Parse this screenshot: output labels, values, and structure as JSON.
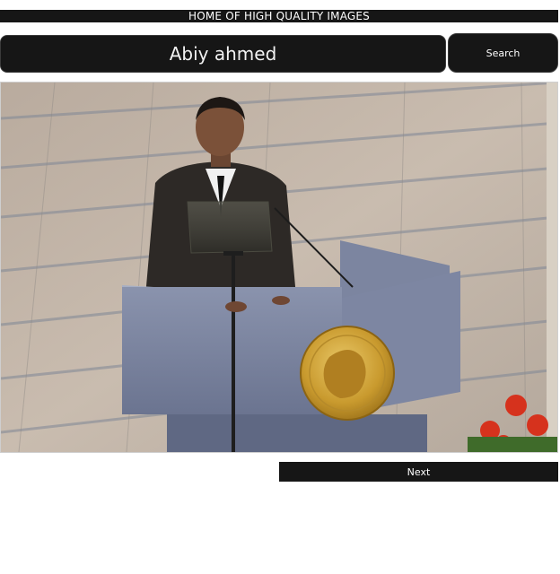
{
  "header": {
    "title": "HOME OF HIGH QUALITY IMAGES"
  },
  "search": {
    "value": "Abiy ahmed",
    "button_label": "Search"
  },
  "pager": {
    "next_label": "Next"
  }
}
